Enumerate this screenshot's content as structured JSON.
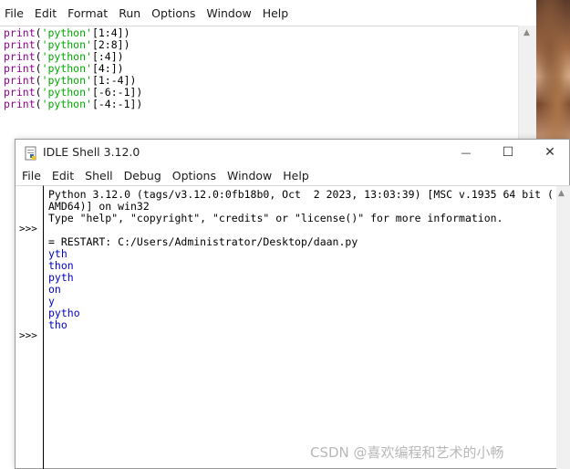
{
  "editor": {
    "menu": [
      "File",
      "Edit",
      "Format",
      "Run",
      "Options",
      "Window",
      "Help"
    ],
    "lines": [
      {
        "kw": "print",
        "open": "(",
        "str": "'python'",
        "rest": "[1:4])"
      },
      {
        "kw": "print",
        "open": "(",
        "str": "'python'",
        "rest": "[2:8])"
      },
      {
        "kw": "print",
        "open": "(",
        "str": "'python'",
        "rest": "[:4])"
      },
      {
        "kw": "print",
        "open": "(",
        "str": "'python'",
        "rest": "[4:])"
      },
      {
        "kw": "print",
        "open": "(",
        "str": "'python'",
        "rest": "[1:-4])"
      },
      {
        "kw": "print",
        "open": "(",
        "str": "'python'",
        "rest": "[-6:-1])"
      },
      {
        "kw": "print",
        "open": "(",
        "str": "'python'",
        "rest": "[-4:-1])"
      }
    ],
    "scroll_up_icon": "▲"
  },
  "shell": {
    "title": "IDLE Shell 3.12.0",
    "controls": {
      "minimize": "—",
      "maximize": "☐",
      "close": "✕"
    },
    "menu": [
      "File",
      "Edit",
      "Shell",
      "Debug",
      "Options",
      "Window",
      "Help"
    ],
    "prompts": [
      ">>>",
      ">>>"
    ],
    "banner": [
      "Python 3.12.0 (tags/v3.12.0:0fb18b0, Oct  2 2023, 13:03:39) [MSC v.1935 64 bit (",
      "AMD64)] on win32",
      "Type \"help\", \"copyright\", \"credits\" or \"license()\" for more information."
    ],
    "restart": "= RESTART: C:/Users/Administrator/Desktop/daan.py",
    "output": [
      "yth",
      "thon",
      "pyth",
      "on",
      "y",
      "pytho",
      "tho"
    ],
    "scroll_up_icon": "▲"
  },
  "watermark": "CSDN @喜欢编程和艺术的小畅",
  "colors": {
    "keyword": "#900090",
    "string": "#00aa00",
    "output": "#0000cc"
  }
}
